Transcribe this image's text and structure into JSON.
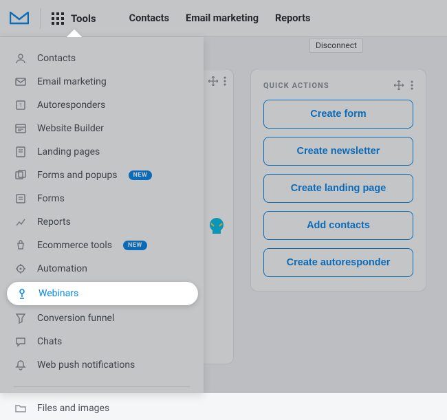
{
  "top": {
    "tools_label": "Tools",
    "nav": [
      "Contacts",
      "Email marketing",
      "Reports"
    ]
  },
  "tooltip": "Disconnect",
  "quick_actions": {
    "title": "QUICK ACTIONS",
    "buttons": [
      "Create form",
      "Create newsletter",
      "Create landing page",
      "Add contacts",
      "Create autoresponder"
    ]
  },
  "dd": {
    "items": [
      {
        "icon": "contacts-icon",
        "label": "Contacts",
        "new": false
      },
      {
        "icon": "envelope-icon",
        "label": "Email marketing",
        "new": false
      },
      {
        "icon": "autoresponder-icon",
        "label": "Autoresponders",
        "new": false
      },
      {
        "icon": "website-icon",
        "label": "Website Builder",
        "new": false
      },
      {
        "icon": "landing-icon",
        "label": "Landing pages",
        "new": false
      },
      {
        "icon": "forms-popups-icon",
        "label": "Forms and popups",
        "new": true
      },
      {
        "icon": "forms-icon",
        "label": "Forms",
        "new": false
      },
      {
        "icon": "reports-icon",
        "label": "Reports",
        "new": false
      },
      {
        "icon": "ecommerce-icon",
        "label": "Ecommerce tools",
        "new": true
      },
      {
        "icon": "automation-icon",
        "label": "Automation",
        "new": false
      },
      {
        "icon": "webinars-icon",
        "label": "Webinars",
        "new": false,
        "highlight": true
      },
      {
        "icon": "funnel-icon",
        "label": "Conversion funnel",
        "new": false
      },
      {
        "icon": "chats-icon",
        "label": "Chats",
        "new": false
      },
      {
        "icon": "webpush-icon",
        "label": "Web push notifications",
        "new": false
      }
    ],
    "files_label": "Files and images",
    "badge": "NEW"
  },
  "colors": {
    "accent": "#0a87ea"
  }
}
